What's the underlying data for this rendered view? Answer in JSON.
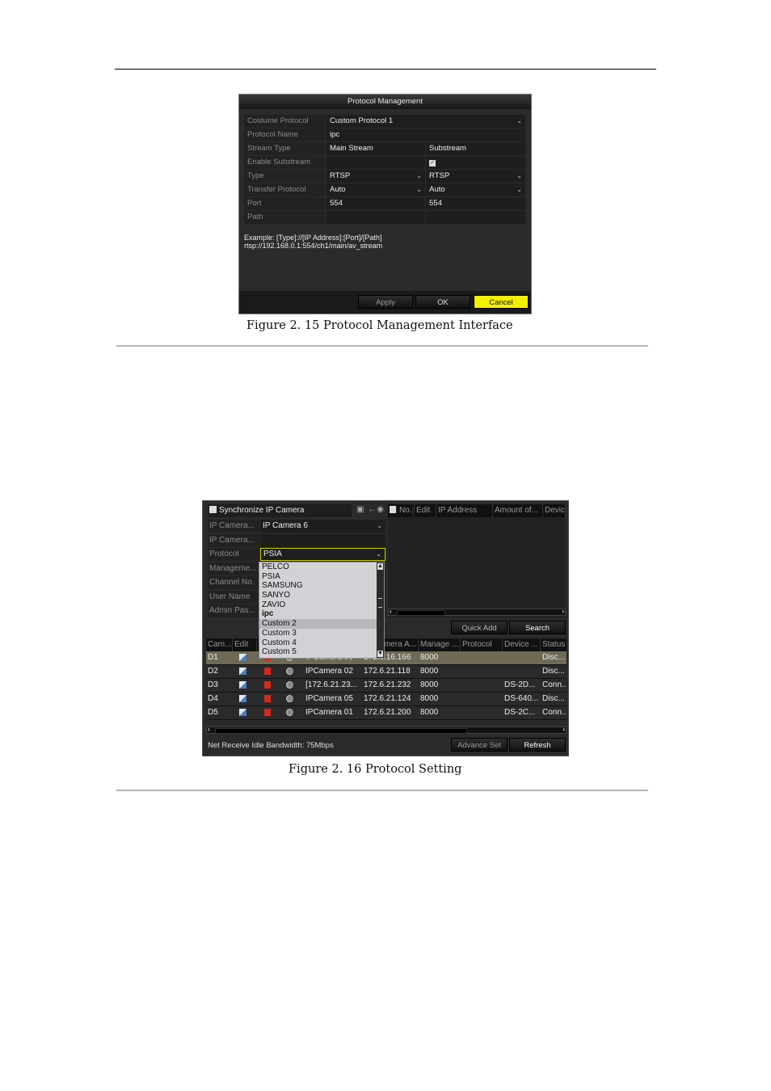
{
  "fig15": {
    "title": "Protocol Management",
    "rows": [
      {
        "label": "Costume Protocol",
        "value": "Custom Protocol 1",
        "dropdown": true
      },
      {
        "label": "Protocol Name",
        "value": "ipc"
      },
      {
        "label": "Stream Type",
        "main": "Main Stream",
        "sub": "Substream"
      },
      {
        "label": "Enable Substream",
        "main": "",
        "sub_checked": true
      },
      {
        "label": "Type",
        "main": "RTSP",
        "sub": "RTSP"
      },
      {
        "label": "Transfer Protocol",
        "main": "Auto",
        "sub": "Auto"
      },
      {
        "label": "Port",
        "main": "554",
        "sub": "554"
      },
      {
        "label": "Path",
        "main": "",
        "sub": ""
      }
    ],
    "example_line1": "Example: [Type]://[IP Address]:[Port]/[Path]",
    "example_line2": "rtsp://192.168.0.1:554/ch1/main/av_stream",
    "buttons": {
      "apply": "Apply",
      "ok": "OK",
      "cancel": "Cancel"
    },
    "caption": "Figure 2. 15  Protocol Management Interface"
  },
  "fig16": {
    "sync_label": "Synchronize IP Camera",
    "form": [
      {
        "label": "IP Camera...",
        "value": "IP Camera 6"
      },
      {
        "label": "IP Camera...",
        "value": ""
      },
      {
        "label": "Protocol",
        "value": "PSIA"
      },
      {
        "label": "Manageme...",
        "value": ""
      },
      {
        "label": "Channel No.",
        "value": ""
      },
      {
        "label": "User Name",
        "value": ""
      },
      {
        "label": "Admin Pas...",
        "value": ""
      }
    ],
    "protocol_options": [
      "PELCO",
      "PSIA",
      "SAMSUNG",
      "SANYO",
      "ZAVIO",
      "ipc",
      "Custom 2",
      "Custom 3",
      "Custom 4",
      "Custom 5"
    ],
    "protocol_highlighted": "Custom 2",
    "right_table_headers": [
      "No.",
      "Edit",
      "IP Address",
      "Amount of...",
      "Devic"
    ],
    "buttons": {
      "quick_add": "Quick Add",
      "search": "Search",
      "advance_set": "Advance Set",
      "refresh": "Refresh"
    },
    "table_headers": [
      "Cam...",
      "Edit",
      "",
      "",
      "...mera A...",
      "Manage ...",
      "Protocol",
      "Device ...",
      "Status"
    ],
    "rows": [
      {
        "cam": "D1",
        "name": "IPCamera 06",
        "ip": "172.6.16.166",
        "port": "8000",
        "protocol": "",
        "device": "",
        "status": "Disc..."
      },
      {
        "cam": "D2",
        "name": "IPCamera 02",
        "ip": "172.6.21.118",
        "port": "8000",
        "protocol": "",
        "device": "",
        "status": "Disc..."
      },
      {
        "cam": "D3",
        "name": "[172.6.21.23...",
        "ip": "172.6.21.232",
        "port": "8000",
        "protocol": "",
        "device": "DS-2D...",
        "status": "Conn..."
      },
      {
        "cam": "D4",
        "name": "IPCamera 05",
        "ip": "172.6.21.124",
        "port": "8000",
        "protocol": "",
        "device": "DS-640...",
        "status": "Disc..."
      },
      {
        "cam": "D5",
        "name": "IPCamera 01",
        "ip": "172.6.21.200",
        "port": "8000",
        "protocol": "",
        "device": "DS-2C...",
        "status": "Conn..."
      }
    ],
    "bandwidth": "Net Receive Idle Bandwidth: 75Mbps",
    "caption": "Figure 2. 16 Protocol Setting"
  }
}
